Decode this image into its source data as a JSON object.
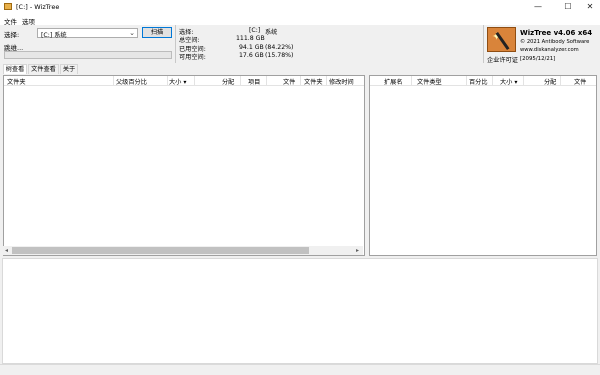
{
  "window": {
    "title": "[C:]  - WizTree",
    "controls": {
      "minimize": "—",
      "maximize": "☐",
      "close": "✕"
    }
  },
  "menu": [
    "文件",
    "选项"
  ],
  "scan": {
    "select_label": "选择:",
    "drive_value": "[C:] 系统",
    "scan_button": "扫描",
    "browse_label": "跳维..."
  },
  "drive_info": {
    "rows": [
      {
        "label": "选择:",
        "value": "[C:]",
        "extra": "系统"
      },
      {
        "label": "总空间:",
        "value": "111.8 GB",
        "extra": ""
      },
      {
        "label": "已用空间:",
        "value": "94.1 GB",
        "extra": "(84.22%)"
      },
      {
        "label": "可用空间:",
        "value": "17.6 GB",
        "extra": "(15.78%)"
      }
    ]
  },
  "brand": {
    "name": "WizTree v4.06 x64",
    "copyright": "© 2021 Antibody Software",
    "website": "www.diskanalyzer.com",
    "license": "企业许可证",
    "license_date": "[2095/12/21]"
  },
  "tabs": [
    {
      "label": "树查看",
      "active": true
    },
    {
      "label": "文件查看",
      "active": false
    },
    {
      "label": "关于",
      "active": false
    }
  ],
  "left_columns": [
    "文件夹",
    "父级百分比",
    "大小 ▾",
    "分配",
    "项目",
    "文件",
    "文件夹",
    "修改时间"
  ],
  "right_columns": [
    "扩展名",
    "文件类型",
    "百分比",
    "大小 ▾",
    "分配",
    "文件"
  ],
  "scrollbar": {
    "left_arrow": "◂",
    "right_arrow": "▸"
  },
  "colors": {
    "accent": "#0078d7",
    "logo": "#d9843a"
  }
}
